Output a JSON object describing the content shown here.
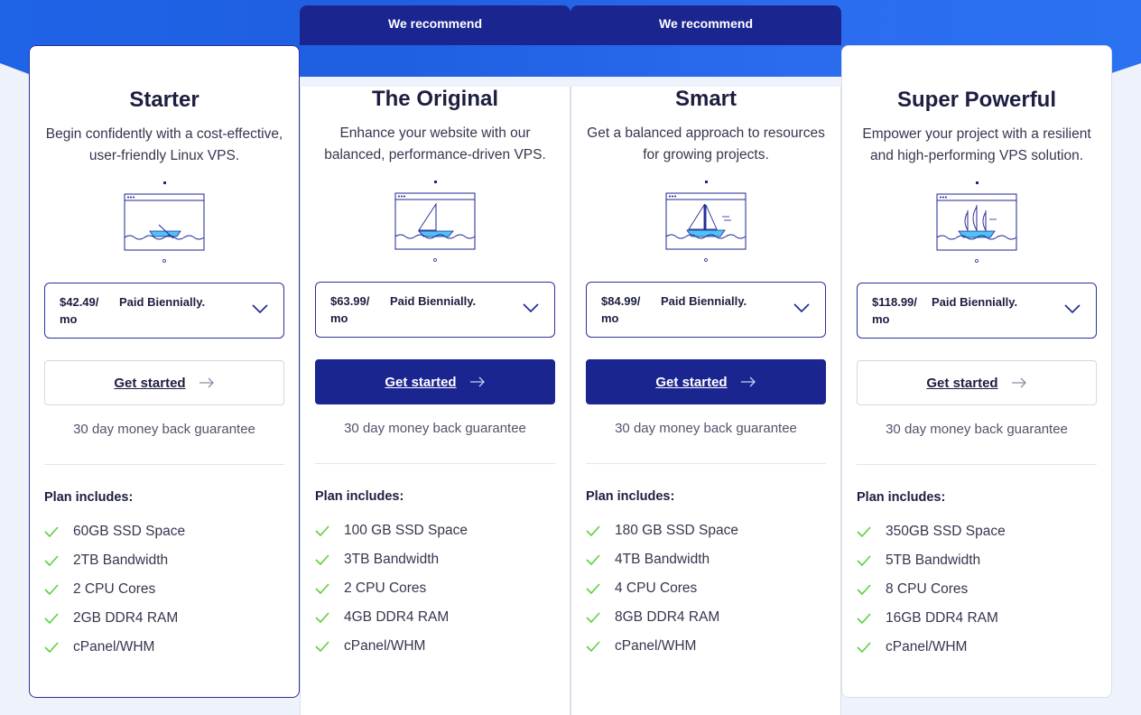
{
  "colors": {
    "primary": "#1b2590",
    "check": "#5fcf3b",
    "accent_water": "#4fc3f7"
  },
  "plans": [
    {
      "ribbon": "",
      "title": "Starter",
      "description": "Begin confidently with a cost-effective, user-friendly Linux VPS.",
      "illustration": "rowboat-icon",
      "price": "$42.49/ mo",
      "billing": "Paid Biennially.",
      "cta": "Get started",
      "guarantee": "30 day money back guarantee",
      "includes_title": "Plan includes:",
      "features": [
        "60GB SSD Space",
        "2TB Bandwidth",
        "2 CPU Cores",
        "2GB DDR4 RAM",
        "cPanel/WHM"
      ]
    },
    {
      "ribbon": "We recommend",
      "title": "The Original",
      "description": "Enhance your website with our balanced, performance-driven VPS.",
      "illustration": "sailboat-icon",
      "price": "$63.99/ mo",
      "billing": "Paid Biennially.",
      "cta": "Get started",
      "guarantee": "30 day money back guarantee",
      "includes_title": "Plan includes:",
      "features": [
        "100 GB SSD Space",
        "3TB Bandwidth",
        "2 CPU Cores",
        "4GB DDR4 RAM",
        "cPanel/WHM"
      ]
    },
    {
      "ribbon": "We recommend",
      "title": "Smart",
      "description": "Get a balanced approach to resources for growing projects.",
      "illustration": "yacht-icon",
      "price": "$84.99/ mo",
      "billing": "Paid Biennially.",
      "cta": "Get started",
      "guarantee": "30 day money back guarantee",
      "includes_title": "Plan includes:",
      "features": [
        "180 GB SSD Space",
        "4TB Bandwidth",
        "4 CPU Cores",
        "8GB DDR4 RAM",
        "cPanel/WHM"
      ]
    },
    {
      "ribbon": "",
      "title": "Super Powerful",
      "description": "Empower your project with a resilient and high-performing VPS solution.",
      "illustration": "tall-ship-icon",
      "price": "$118.99/ mo",
      "billing": "Paid Biennially.",
      "cta": "Get started",
      "guarantee": "30 day money back guarantee",
      "includes_title": "Plan includes:",
      "features": [
        "350GB SSD Space",
        "5TB Bandwidth",
        "8 CPU Cores",
        "16GB DDR4 RAM",
        "cPanel/WHM"
      ]
    }
  ]
}
